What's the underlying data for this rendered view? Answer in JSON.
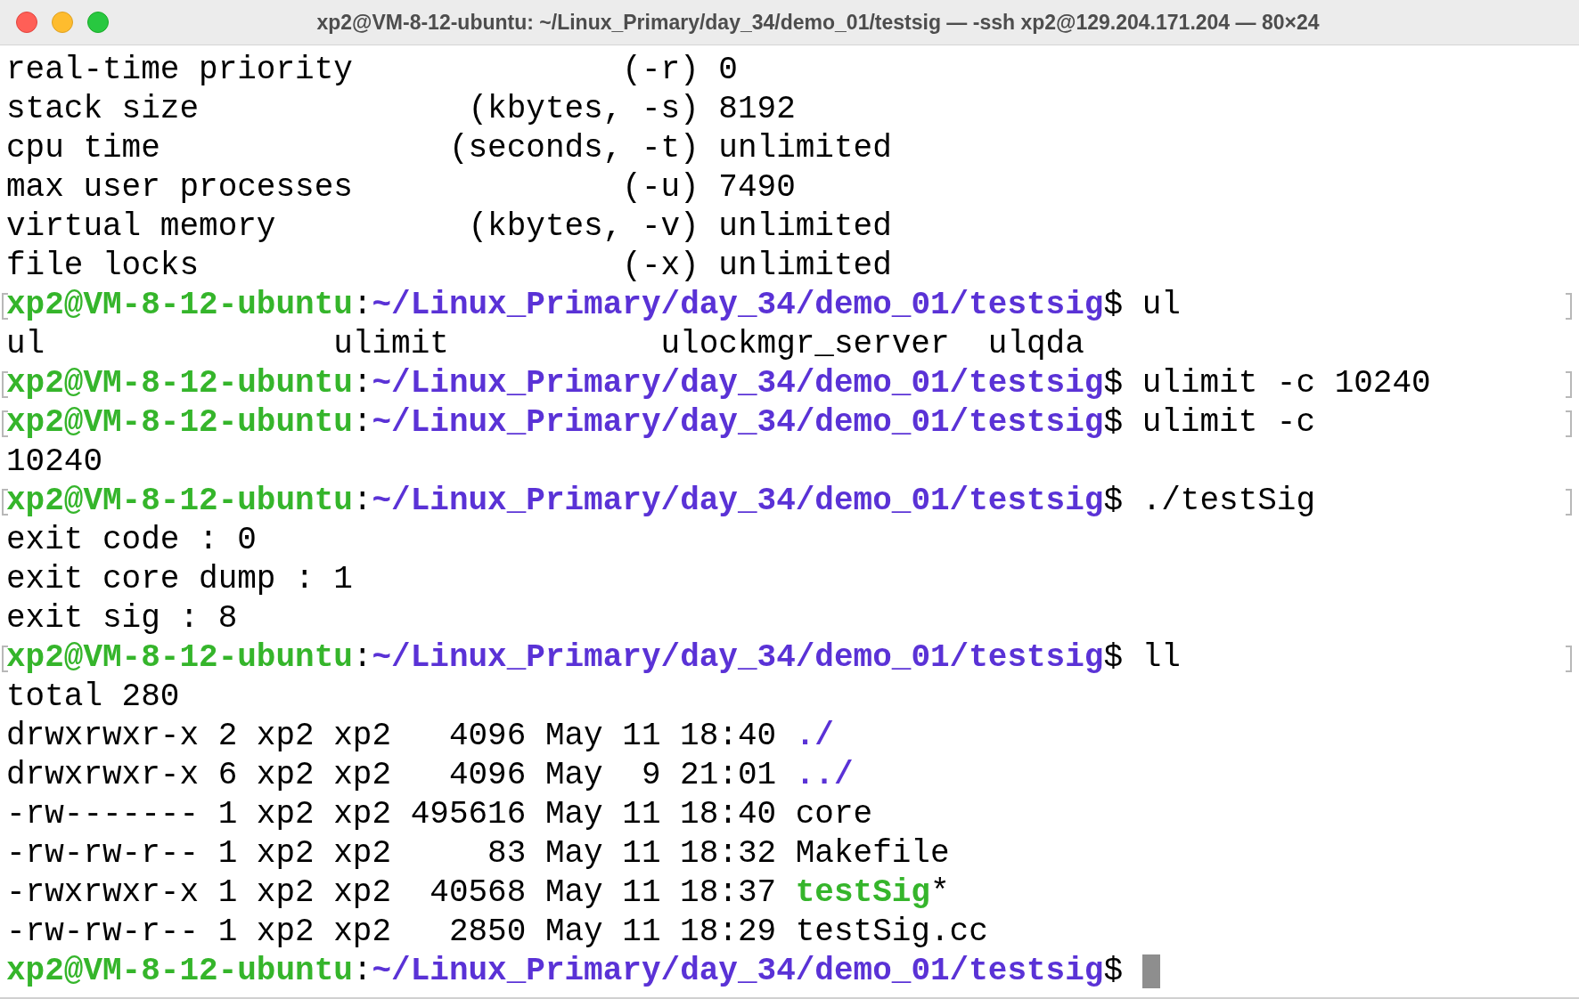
{
  "window": {
    "title": "xp2@VM-8-12-ubuntu: ~/Linux_Primary/day_34/demo_01/testsig — -ssh xp2@129.204.171.204 — 80×24"
  },
  "terminal": {
    "lines": [
      {
        "marked": false,
        "segments": [
          {
            "kind": "plain",
            "text": "real-time priority              (-r) 0"
          }
        ]
      },
      {
        "marked": false,
        "segments": [
          {
            "kind": "plain",
            "text": "stack size              (kbytes, -s) 8192"
          }
        ]
      },
      {
        "marked": false,
        "segments": [
          {
            "kind": "plain",
            "text": "cpu time               (seconds, -t) unlimited"
          }
        ]
      },
      {
        "marked": false,
        "segments": [
          {
            "kind": "plain",
            "text": "max user processes              (-u) 7490"
          }
        ]
      },
      {
        "marked": false,
        "segments": [
          {
            "kind": "plain",
            "text": "virtual memory          (kbytes, -v) unlimited"
          }
        ]
      },
      {
        "marked": false,
        "segments": [
          {
            "kind": "plain",
            "text": "file locks                      (-x) unlimited"
          }
        ]
      },
      {
        "marked": true,
        "segments": [
          {
            "kind": "user",
            "text": "xp2@VM-8-12-ubuntu"
          },
          {
            "kind": "plain",
            "text": ":"
          },
          {
            "kind": "path",
            "text": "~/Linux_Primary/day_34/demo_01/testsig"
          },
          {
            "kind": "plain",
            "text": "$ ul"
          }
        ]
      },
      {
        "marked": false,
        "segments": [
          {
            "kind": "plain",
            "text": "ul               ulimit           ulockmgr_server  ulqda"
          }
        ]
      },
      {
        "marked": true,
        "segments": [
          {
            "kind": "user",
            "text": "xp2@VM-8-12-ubuntu"
          },
          {
            "kind": "plain",
            "text": ":"
          },
          {
            "kind": "path",
            "text": "~/Linux_Primary/day_34/demo_01/testsig"
          },
          {
            "kind": "plain",
            "text": "$ ulimit -c 10240"
          }
        ]
      },
      {
        "marked": true,
        "segments": [
          {
            "kind": "user",
            "text": "xp2@VM-8-12-ubuntu"
          },
          {
            "kind": "plain",
            "text": ":"
          },
          {
            "kind": "path",
            "text": "~/Linux_Primary/day_34/demo_01/testsig"
          },
          {
            "kind": "plain",
            "text": "$ ulimit -c"
          }
        ]
      },
      {
        "marked": false,
        "segments": [
          {
            "kind": "plain",
            "text": "10240"
          }
        ]
      },
      {
        "marked": true,
        "segments": [
          {
            "kind": "user",
            "text": "xp2@VM-8-12-ubuntu"
          },
          {
            "kind": "plain",
            "text": ":"
          },
          {
            "kind": "path",
            "text": "~/Linux_Primary/day_34/demo_01/testsig"
          },
          {
            "kind": "plain",
            "text": "$ ./testSig"
          }
        ]
      },
      {
        "marked": false,
        "segments": [
          {
            "kind": "plain",
            "text": "exit code : 0"
          }
        ]
      },
      {
        "marked": false,
        "segments": [
          {
            "kind": "plain",
            "text": "exit core dump : 1"
          }
        ]
      },
      {
        "marked": false,
        "segments": [
          {
            "kind": "plain",
            "text": "exit sig : 8"
          }
        ]
      },
      {
        "marked": true,
        "segments": [
          {
            "kind": "user",
            "text": "xp2@VM-8-12-ubuntu"
          },
          {
            "kind": "plain",
            "text": ":"
          },
          {
            "kind": "path",
            "text": "~/Linux_Primary/day_34/demo_01/testsig"
          },
          {
            "kind": "plain",
            "text": "$ ll"
          }
        ]
      },
      {
        "marked": false,
        "segments": [
          {
            "kind": "plain",
            "text": "total 280"
          }
        ]
      },
      {
        "marked": false,
        "segments": [
          {
            "kind": "plain",
            "text": "drwxrwxr-x 2 xp2 xp2   4096 May 11 18:40 "
          },
          {
            "kind": "dir",
            "text": "./"
          }
        ]
      },
      {
        "marked": false,
        "segments": [
          {
            "kind": "plain",
            "text": "drwxrwxr-x 6 xp2 xp2   4096 May  9 21:01 "
          },
          {
            "kind": "dir",
            "text": "../"
          }
        ]
      },
      {
        "marked": false,
        "segments": [
          {
            "kind": "plain",
            "text": "-rw------- 1 xp2 xp2 495616 May 11 18:40 core"
          }
        ]
      },
      {
        "marked": false,
        "segments": [
          {
            "kind": "plain",
            "text": "-rw-rw-r-- 1 xp2 xp2     83 May 11 18:32 Makefile"
          }
        ]
      },
      {
        "marked": false,
        "segments": [
          {
            "kind": "plain",
            "text": "-rwxrwxr-x 1 xp2 xp2  40568 May 11 18:37 "
          },
          {
            "kind": "exec",
            "text": "testSig"
          },
          {
            "kind": "plain",
            "text": "*"
          }
        ]
      },
      {
        "marked": false,
        "segments": [
          {
            "kind": "plain",
            "text": "-rw-rw-r-- 1 xp2 xp2   2850 May 11 18:29 testSig.cc"
          }
        ]
      },
      {
        "marked": false,
        "cursor": true,
        "segments": [
          {
            "kind": "user",
            "text": "xp2@VM-8-12-ubuntu"
          },
          {
            "kind": "plain",
            "text": ":"
          },
          {
            "kind": "path",
            "text": "~/Linux_Primary/day_34/demo_01/testsig"
          },
          {
            "kind": "plain",
            "text": "$ "
          }
        ]
      }
    ]
  }
}
